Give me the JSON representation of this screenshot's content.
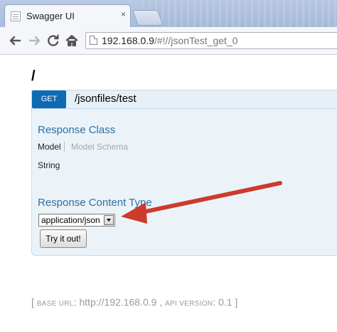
{
  "browser": {
    "tab_title": "Swagger UI",
    "close_glyph": "×",
    "url_host": "192.168.0.9",
    "url_rest": "/#!//jsonTest_get_0",
    "icons": [
      "back-icon",
      "forward-icon",
      "reload-icon",
      "home-icon",
      "page-icon"
    ]
  },
  "resource": {
    "path": "/"
  },
  "operation": {
    "method": "GET",
    "path": "/jsonfiles/test",
    "method_color": "#0f6ab4",
    "response_class_title": "Response Class",
    "model_tab": "Model",
    "model_schema_tab": "Model Schema",
    "model_type": "String",
    "response_content_type_title": "Response Content Type",
    "content_type_selected": "application/json",
    "try_button": "Try it out!"
  },
  "footer": {
    "open_bracket": "[",
    "base_url_label": "base url",
    "base_url_value": "http://192.168.0.9",
    "separator": ",",
    "api_version_label": "api version",
    "api_version_value": "0.1",
    "close_bracket": "]"
  },
  "annotation": {
    "arrow_color": "#cc3b2b"
  }
}
